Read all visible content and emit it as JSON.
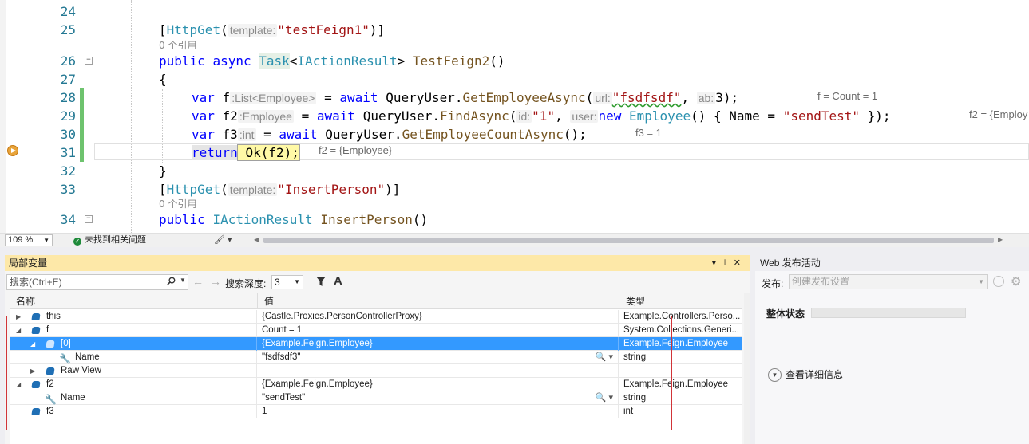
{
  "editor": {
    "lines": [
      {
        "num": "24"
      },
      {
        "num": "25"
      },
      {
        "num": "26"
      },
      {
        "num": "27"
      },
      {
        "num": "28"
      },
      {
        "num": "29"
      },
      {
        "num": "30"
      },
      {
        "num": "31"
      },
      {
        "num": "32"
      },
      {
        "num": "33"
      },
      {
        "num": "34"
      }
    ],
    "code_lens_1": "0 个引用",
    "code_lens_2": "0 个引用",
    "l25": {
      "attr": "HttpGet",
      "hint": "template:",
      "str": "\"testFeign1\""
    },
    "l26": {
      "kw1": "public",
      "kw2": "async",
      "t1": "Task",
      "t2": "IActionResult",
      "method": "TestFeign2"
    },
    "l28": {
      "var": "var",
      "name": "f",
      "hint": ":List<Employee>",
      "await": "await",
      "obj": "QueryUser",
      "method": "GetEmployeeAsync",
      "hint_url": "url:",
      "str": "\"fsdfsdf\"",
      "hint_ab": "ab:",
      "num": "3",
      "tip": "f = Count = 1"
    },
    "l29": {
      "var": "var",
      "name": "f2",
      "hint": ":Employee",
      "await": "await",
      "obj": "QueryUser",
      "method": "FindAsync",
      "hint_id": "id:",
      "str": "\"1\"",
      "hint_user": "user:",
      "new": "new",
      "type": "Employee",
      "prop": "Name",
      "str2": "\"sendTest\"",
      "tip": "f2 = {Employ"
    },
    "l30": {
      "var": "var",
      "name": "f3",
      "hint": ":int",
      "await": "await",
      "obj": "QueryUser",
      "method": "GetEmployeeCountAsync",
      "tip": "f3 = 1"
    },
    "l31": {
      "ret": "return",
      "stmt": "Ok(f2);",
      "tip": "f2 = {Employee}"
    },
    "l33": {
      "attr": "HttpGet",
      "hint": "template:",
      "str": "\"InsertPerson\""
    },
    "l34": {
      "kw1": "public",
      "t1": "IActionResult",
      "method": "InsertPerson"
    }
  },
  "status": {
    "zoom": "109 %",
    "issues": "未找到相关问题"
  },
  "locals": {
    "title": "局部变量",
    "search_placeholder": "搜索(Ctrl+E)",
    "depth_label": "搜索深度:",
    "depth_value": "3",
    "columns": {
      "name": "名称",
      "value": "值",
      "type": "类型"
    },
    "rows": [
      {
        "name": "this",
        "value": "{Castle.Proxies.PersonControllerProxy}",
        "type": "Example.Controllers.Perso..."
      },
      {
        "name": "f",
        "value": "Count = 1",
        "type": "System.Collections.Generi..."
      },
      {
        "name": "[0]",
        "value": "{Example.Feign.Employee}",
        "type": "Example.Feign.Employee"
      },
      {
        "name": "Name",
        "value": "\"fsdfsdf3\"",
        "type": "string"
      },
      {
        "name": "Raw View",
        "value": "",
        "type": ""
      },
      {
        "name": "f2",
        "value": "{Example.Feign.Employee}",
        "type": "Example.Feign.Employee"
      },
      {
        "name": "Name",
        "value": "\"sendTest\"",
        "type": "string"
      },
      {
        "name": "f3",
        "value": "1",
        "type": "int"
      }
    ]
  },
  "publish": {
    "title": "Web 发布活动",
    "label": "发布:",
    "select_value": "创建发布设置",
    "overall": "整体状态",
    "details": "查看详细信息"
  },
  "colors": {
    "accent": "#3399ff",
    "tab_active": "#fde8a8",
    "highlight_box": "#d13438",
    "change_bar": "#6ec36e"
  }
}
